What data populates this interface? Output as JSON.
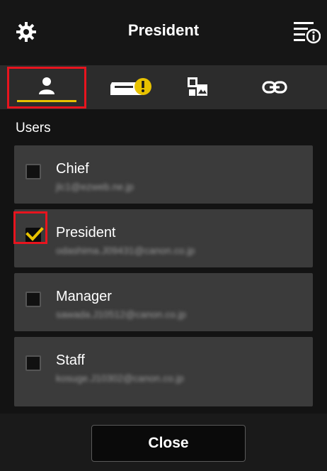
{
  "header": {
    "title": "President",
    "left_icon": "gear-icon",
    "right_icon": "menu-info-icon"
  },
  "tabs": [
    {
      "icon": "user-icon",
      "active": true
    },
    {
      "icon": "printer-warning-icon",
      "active": false
    },
    {
      "icon": "photo-layout-icon",
      "active": false
    },
    {
      "icon": "link-icon",
      "active": false
    }
  ],
  "users_section": {
    "label": "Users",
    "items": [
      {
        "name": "Chief",
        "email": "jlc1@ezweb.ne.jp",
        "checked": false
      },
      {
        "name": "President",
        "email": "odashima.J09431@canon.co.jp",
        "checked": true
      },
      {
        "name": "Manager",
        "email": "sawada.J10512@canon.co.jp",
        "checked": false
      },
      {
        "name": "Staff",
        "email": "kosuge.J10302@canon.co.jp",
        "checked": false
      }
    ]
  },
  "footer": {
    "close_label": "Close"
  },
  "colors": {
    "accent_yellow": "#e8c200",
    "highlight_red": "#e8141e",
    "background": "#131313",
    "card": "#3b3b3b"
  }
}
